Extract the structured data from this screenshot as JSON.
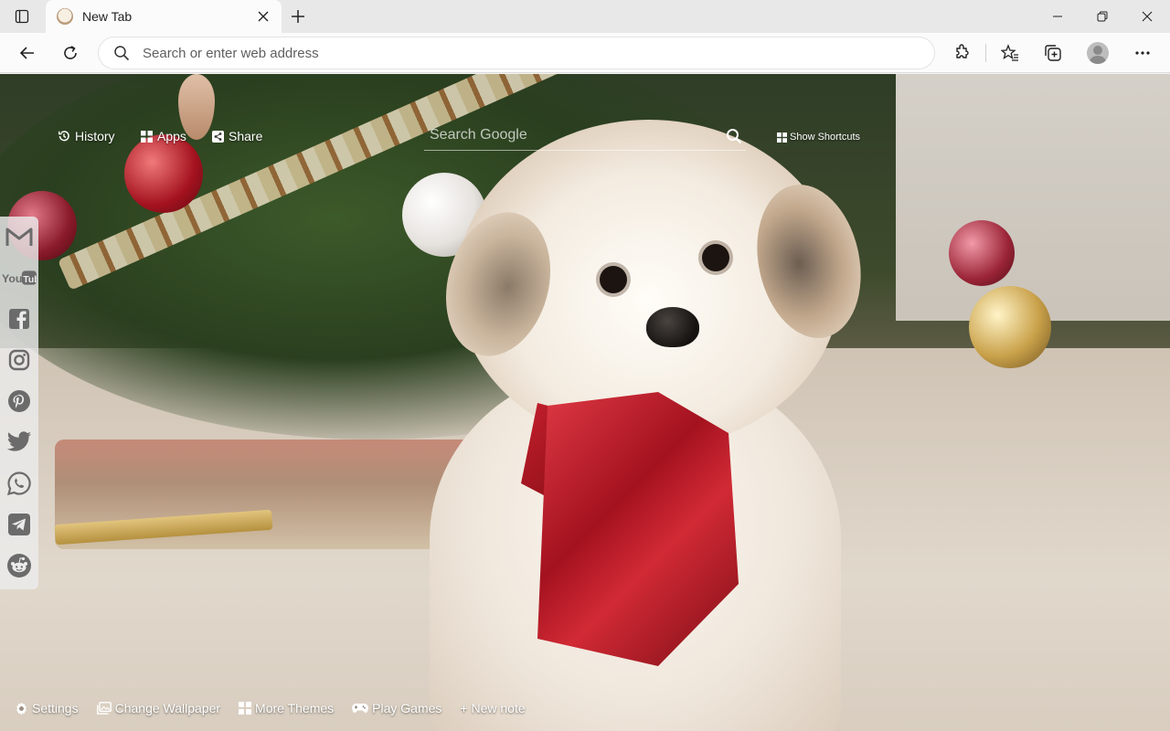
{
  "browser": {
    "tab": {
      "title": "New Tab"
    },
    "address_bar": {
      "placeholder": "Search or enter web address"
    }
  },
  "newtab": {
    "nav": {
      "history_label": "History",
      "apps_label": "Apps",
      "share_label": "Share"
    },
    "search": {
      "placeholder": "Search Google"
    },
    "show_shortcuts_label": "Show Shortcuts",
    "social_links": [
      "gmail-icon",
      "youtube-icon",
      "facebook-icon",
      "instagram-icon",
      "pinterest-icon",
      "twitter-icon",
      "whatsapp-icon",
      "telegram-icon",
      "reddit-icon"
    ],
    "bottom": {
      "settings_label": "Settings",
      "change_wallpaper_label": "Change Wallpaper",
      "more_themes_label": "More Themes",
      "play_games_label": "Play Games",
      "new_note_label": "+ New note"
    }
  },
  "colors": {
    "titlebar_bg": "#e8e8e8",
    "toolbar_bg": "#fbfbfb",
    "overlay_text": "#ffffff",
    "social_panel_bg": "#ebebeb",
    "social_icon": "#6b6b6b"
  }
}
